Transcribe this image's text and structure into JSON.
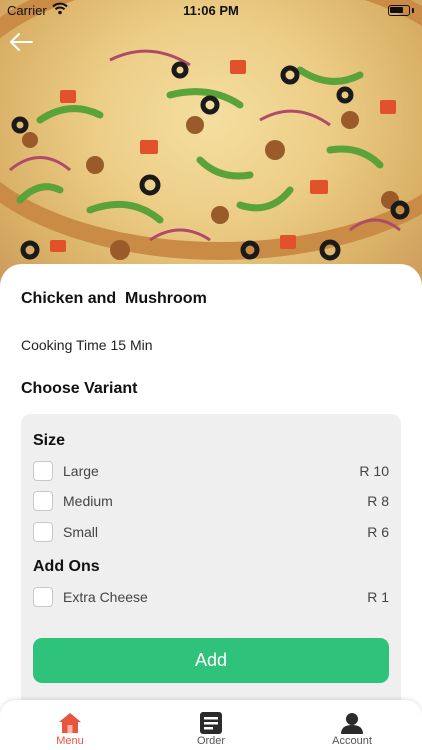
{
  "status_bar": {
    "carrier": "Carrier",
    "time": "11:06 PM"
  },
  "item": {
    "title": "Chicken and  Mushroom",
    "cooking_time": "Cooking Time 15 Min"
  },
  "variant_heading": "Choose Variant",
  "size": {
    "heading": "Size",
    "options": [
      {
        "label": "Large",
        "price": "R 10",
        "checked": false
      },
      {
        "label": "Medium",
        "price": "R 8",
        "checked": false
      },
      {
        "label": "Small",
        "price": "R 6",
        "checked": false
      }
    ]
  },
  "addons": {
    "heading": "Add Ons",
    "options": [
      {
        "label": "Extra Cheese",
        "price": "R 1",
        "checked": false
      }
    ]
  },
  "add_button": "Add",
  "tabs": [
    {
      "label": "Menu",
      "icon": "home-icon",
      "active": true
    },
    {
      "label": "Order",
      "icon": "order-list-icon",
      "active": false
    },
    {
      "label": "Account",
      "icon": "account-icon",
      "active": false
    }
  ],
  "colors": {
    "accent_green": "#2fc27a",
    "active_tab": "#e8553e",
    "panel_bg": "#efefef"
  }
}
